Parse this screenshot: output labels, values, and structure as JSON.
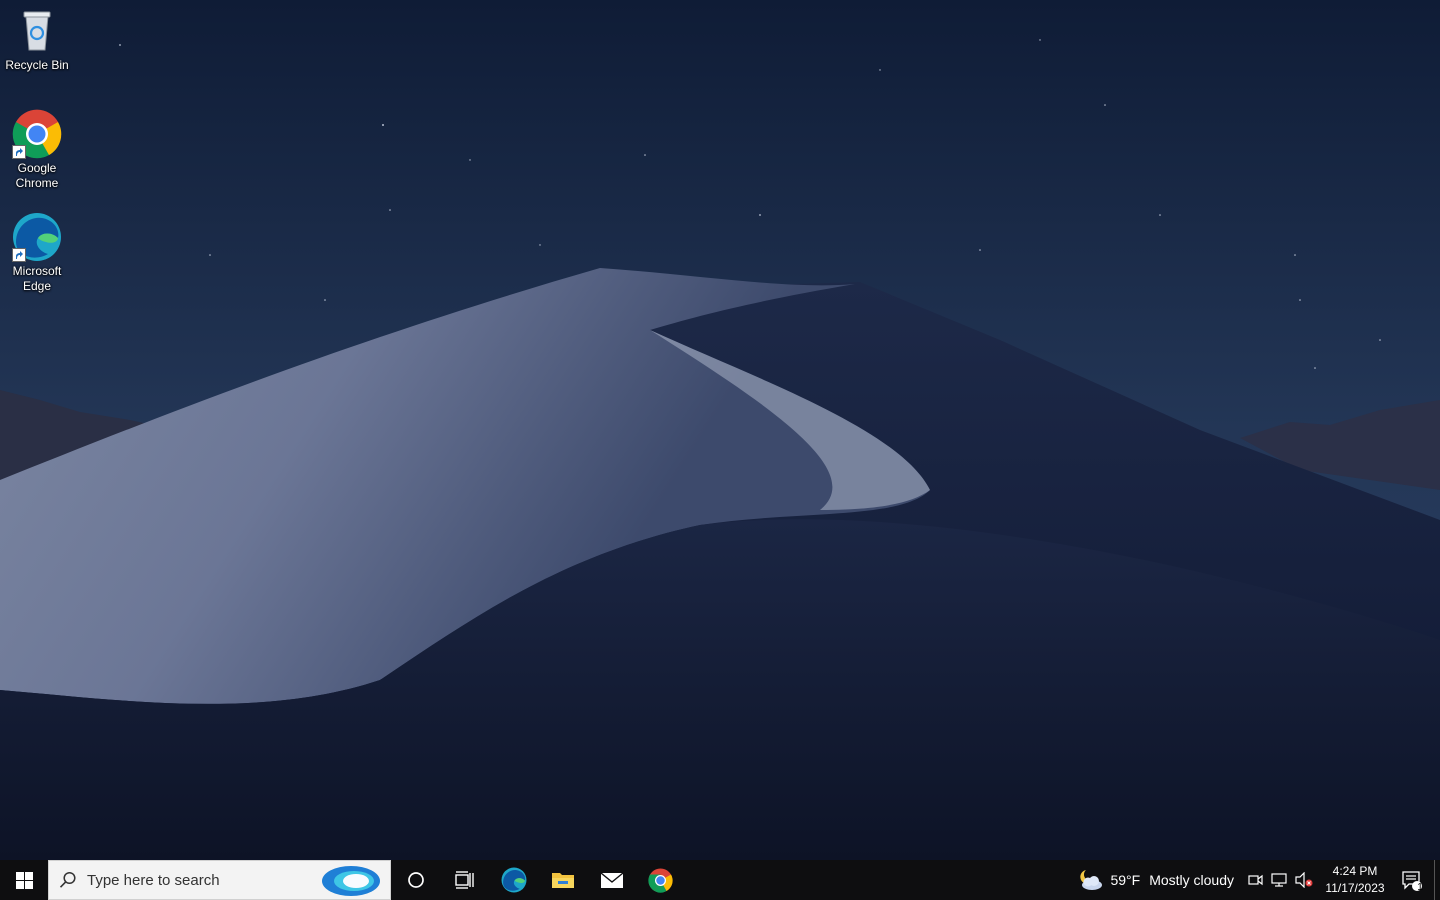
{
  "desktop": {
    "icons": [
      {
        "label": "Recycle Bin",
        "icon": "recycle-bin-icon"
      },
      {
        "label": "Google Chrome",
        "icon": "chrome-icon"
      },
      {
        "label": "Microsoft Edge",
        "icon": "edge-icon"
      }
    ]
  },
  "taskbar": {
    "start_icon": "windows-logo-icon",
    "search": {
      "placeholder": "Type here to search",
      "icon": "search-icon"
    },
    "pinned": [
      {
        "name": "Cortana",
        "icon": "cortana-icon"
      },
      {
        "name": "Task View",
        "icon": "task-view-icon"
      },
      {
        "name": "Microsoft Edge",
        "icon": "edge-icon"
      },
      {
        "name": "File Explorer",
        "icon": "folder-icon"
      },
      {
        "name": "Mail",
        "icon": "mail-icon"
      },
      {
        "name": "Google Chrome",
        "icon": "chrome-icon"
      }
    ],
    "tray": {
      "weather": {
        "temp": "59°F",
        "condition": "Mostly cloudy",
        "icon": "partly-cloudy-night-icon"
      },
      "time": "4:24 PM",
      "date": "11/17/2023",
      "notification_count": "1"
    }
  },
  "colors": {
    "taskbar": "#0e0e10",
    "sky": "#1a2848",
    "dune_light": "#8a93ab"
  }
}
